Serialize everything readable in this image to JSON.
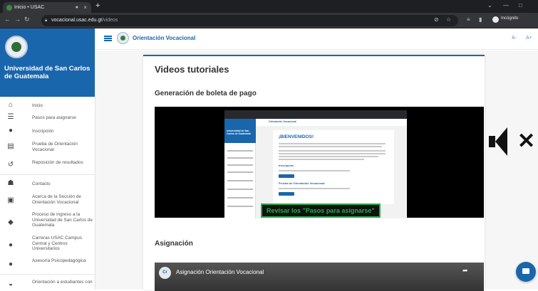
{
  "browser": {
    "tab_title": "Inicio • USAC",
    "tab_close": "×",
    "tab_mark": "●",
    "new_tab": "+",
    "url_host": "vocacional.usac.edu.gt",
    "url_path": "/videos",
    "incognito_label": "Incógnito",
    "win_min": "—",
    "win_max": "□",
    "win_down": "⌄"
  },
  "sidebar": {
    "university": "Universidad de San Carlos de Guatemala",
    "items": [
      {
        "icon": "home-icon",
        "glyph": "⌂",
        "label": "Inicio"
      },
      {
        "icon": "list-icon",
        "glyph": "☰",
        "label": "Pasos para asignarse"
      },
      {
        "icon": "info-icon",
        "glyph": "●",
        "label": "Inscripción"
      },
      {
        "icon": "clipboard-icon",
        "glyph": "▤",
        "label": "Prueba de Orientación Vocacional"
      },
      {
        "icon": "history-icon",
        "glyph": "↺",
        "label": "Reposición de resultados"
      },
      {
        "icon": "contact-icon",
        "glyph": "☗",
        "label": "Contacto"
      },
      {
        "icon": "chat-icon",
        "glyph": "▣",
        "label": "Acerca de la Sección de Orientación Vocacional"
      },
      {
        "icon": "graduation-cap-icon",
        "glyph": "◆",
        "label": "Proceso de ingreso a la Universidad de San Carlos de Guatemala"
      },
      {
        "icon": "info-circle-icon",
        "glyph": "●",
        "label": "Carreras USAC Campus Central y Centros Universitarios"
      },
      {
        "icon": "advice-icon",
        "glyph": "●",
        "label": "Asesoría Psicopedagógica"
      },
      {
        "icon": "orientation-icon",
        "glyph": "◒",
        "label": "Orientación a estudiantes con"
      }
    ]
  },
  "topbar": {
    "title": "Orientación Vocacional",
    "font_small": "A-",
    "font_large": "A+"
  },
  "main": {
    "page_title": "Videos tutoriales",
    "section1_title": "Generación de boleta de pago",
    "video1": {
      "inner_heading": "¡BIENVENIDOS!",
      "inner_app_title": "Orientación Vocacional",
      "inner_university": "Universidad de San Carlos de Guatemala",
      "inner_sub1": "Inscripción",
      "inner_sub2": "Prueba de Orientación Vocacional",
      "caption": "Revisar los \"Pasos para asignarse\""
    },
    "section2_title": "Asignación",
    "video2": {
      "logo_text": "Cr",
      "title": "Asignación Orientación Vocacional",
      "share_icon": "➦"
    }
  },
  "colors": {
    "brand_blue": "#1a66ad",
    "caption_green": "#21b14a"
  }
}
